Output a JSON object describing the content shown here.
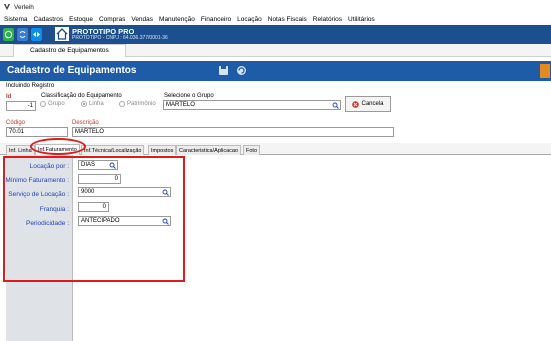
{
  "window": {
    "title": "Verleih"
  },
  "menu": [
    "Sistema",
    "Cadastros",
    "Estoque",
    "Compras",
    "Vendas",
    "Manutenção",
    "Financeiro",
    "Locação",
    "Notas Fiscais",
    "Relatórios",
    "Utilitários"
  ],
  "company": {
    "name": "PROTOTIPO PRO",
    "subtitle": "PROTOTIPO - CNPJ : 64.036.377/0001-36"
  },
  "doc_tab": "Cadastro de Equipamentos",
  "header": {
    "title": "Cadastro de Equipamentos"
  },
  "status": "Incluindo Registro",
  "form": {
    "id_label": "Id",
    "id_value": "-1",
    "classificacao_label": "Classificação do Equipamento",
    "radios": [
      "Grupo",
      "Linha",
      "Patrimônio"
    ],
    "grupo_label": "Selecione o Grupo",
    "grupo_value": "MARTELO",
    "cancel_label": "Cancela",
    "codigo_label": "Código",
    "codigo_value": "70.01",
    "descricao_label": "Descrição",
    "descricao_value": "MARTELO"
  },
  "tabs": [
    "Inf. Linha",
    "Inf.Faturamento",
    "Inf.Técnica/Localização",
    "Impostos",
    "Caracteristica/Aplicacao",
    "Foto"
  ],
  "faturamento": {
    "locacao_por_label": "Locação por :",
    "locacao_por_value": "DIAS",
    "minimo_label": "Mínimo Faturamento :",
    "minimo_value": "0",
    "servico_label": "Serviço de Locação :",
    "servico_value": "9000",
    "franquia_label": "Franquia :",
    "franquia_value": "0",
    "periodicidade_label": "Periodicidade :",
    "periodicidade_value": "ANTECIPADO"
  },
  "colors": {
    "header_blue": "#1e5ca8",
    "top_blue": "#1b4f8f",
    "highlight_red": "#e01b1b",
    "label_blue": "#1c43b8"
  }
}
